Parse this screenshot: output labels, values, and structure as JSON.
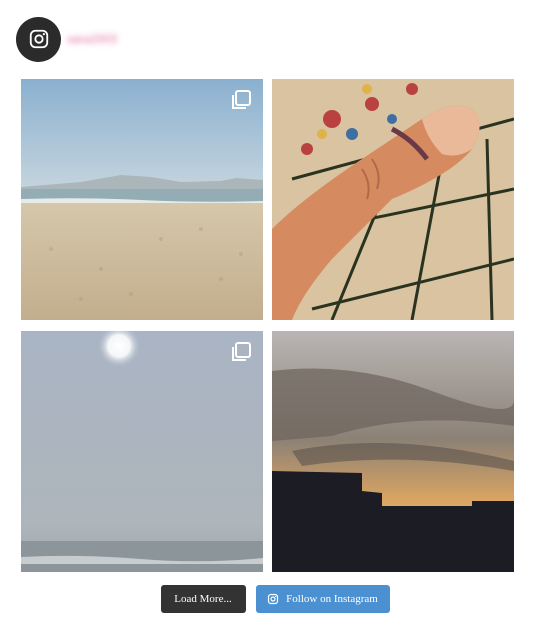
{
  "header": {
    "username": "sara2003",
    "avatar_icon": "instagram-icon"
  },
  "feed": {
    "posts": [
      {
        "subject": "beach",
        "multi": true,
        "multi_icon": "carousel-icon"
      },
      {
        "subject": "thumb",
        "multi": false
      },
      {
        "subject": "hazy-sun",
        "multi": true,
        "multi_icon": "carousel-icon"
      },
      {
        "subject": "sunset",
        "multi": false
      }
    ]
  },
  "actions": {
    "load_more_label": "Load More...",
    "follow_label": "Follow on Instagram",
    "follow_icon": "instagram-icon"
  },
  "colors": {
    "avatar_bg": "#2b2b2b",
    "load_more_bg": "#333333",
    "follow_bg": "#4b91d1"
  }
}
